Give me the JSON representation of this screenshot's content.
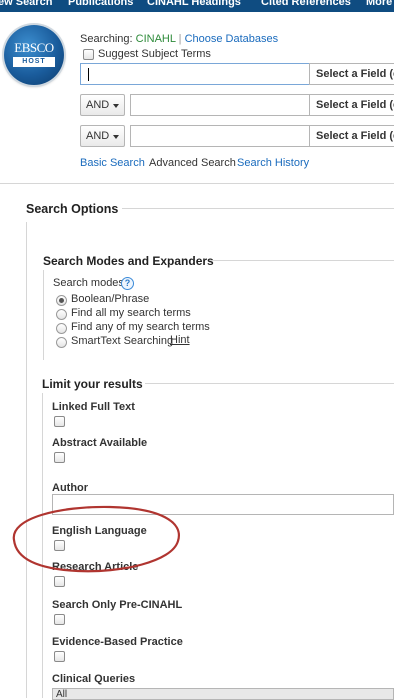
{
  "nav": {
    "items": [
      "ew Search",
      "Publications",
      "CINAHL Headings",
      "Cited References",
      "More"
    ]
  },
  "logo": {
    "line1": "EBSCO",
    "line2": "HOST"
  },
  "search": {
    "searching_label": "Searching:",
    "database": "CINAHL",
    "separator": "|",
    "choose_databases": "Choose Databases",
    "suggest_subject_terms": "Suggest Subject Terms",
    "rows": [
      {
        "operator": "",
        "field": "Select a Field (op"
      },
      {
        "operator": "AND",
        "field": "Select a Field (op"
      },
      {
        "operator": "AND",
        "field": "Select a Field (op"
      }
    ],
    "links": {
      "basic": "Basic Search",
      "advanced": "Advanced Search",
      "history": "Search History"
    }
  },
  "options": {
    "title": "Search Options",
    "modes_section": {
      "title": "Search Modes and Expanders",
      "modes_label": "Search modes",
      "help": "?",
      "modes": [
        "Boolean/Phrase",
        "Find all my search terms",
        "Find any of my search terms",
        "SmartText Searching"
      ],
      "selected": "Boolean/Phrase",
      "hint": "Hint"
    },
    "limits_section": {
      "title": "Limit your results",
      "linked_full_text": "Linked Full Text",
      "abstract_available": "Abstract Available",
      "author": "Author",
      "english_language": "English Language",
      "research_article": "Research Article",
      "pre_cinahl": "Search Only Pre-CINAHL",
      "evidence_based": "Evidence-Based Practice",
      "clinical_queries": "Clinical Queries",
      "clinical_queries_value": "All"
    }
  },
  "colors": {
    "nav_bg": "#0f4c81",
    "link": "#1a6bbd",
    "database": "#2e8b3a",
    "annotation": "#b03530"
  }
}
